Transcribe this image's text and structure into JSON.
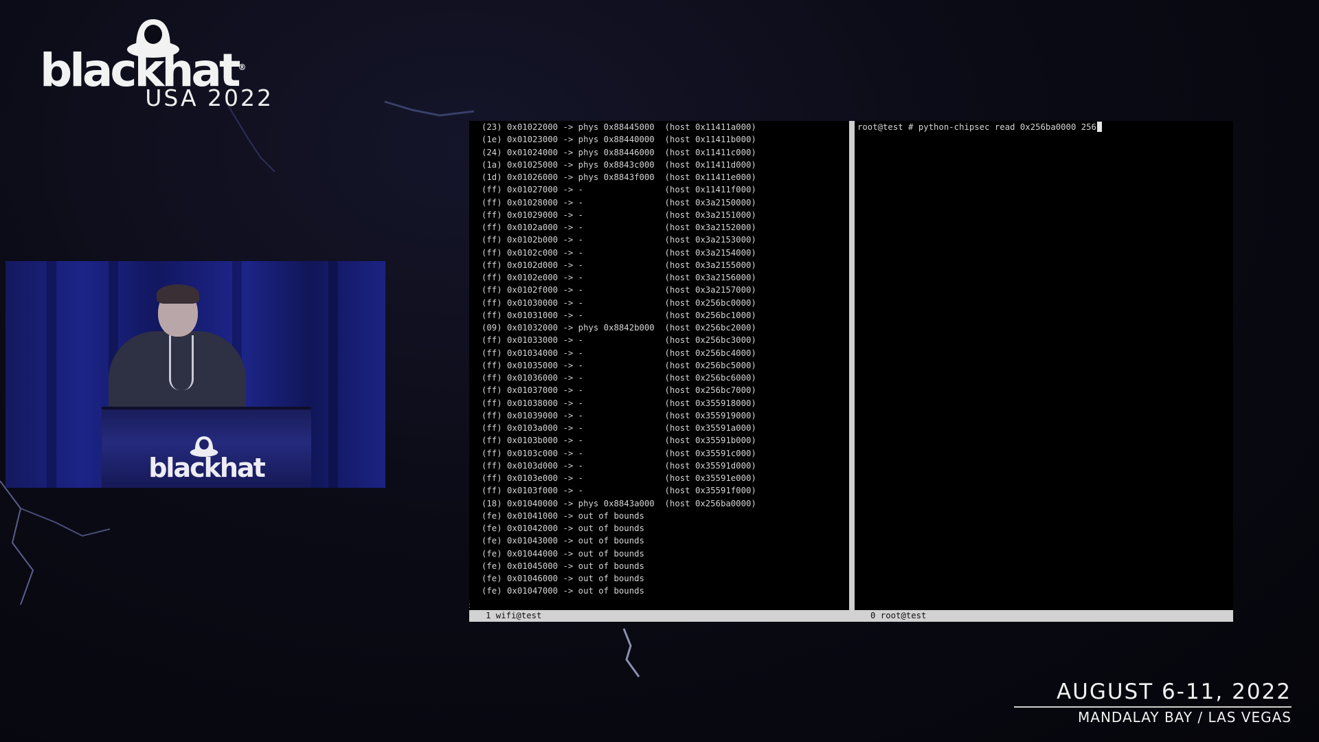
{
  "event": {
    "logo_word": "blackhat",
    "logo_registered": "®",
    "logo_sub": "USA 2022",
    "podium_word": "blackhat",
    "date": "AUGUST 6-11, 2022",
    "venue": "MANDALAY BAY / LAS VEGAS"
  },
  "terminal": {
    "left_pane_lines": [
      "(23) 0x01022000 -> phys 0x88445000  (host 0x11411a000)",
      "(1e) 0x01023000 -> phys 0x88440000  (host 0x11411b000)",
      "(24) 0x01024000 -> phys 0x88446000  (host 0x11411c000)",
      "(1a) 0x01025000 -> phys 0x8843c000  (host 0x11411d000)",
      "(1d) 0x01026000 -> phys 0x8843f000  (host 0x11411e000)",
      "(ff) 0x01027000 -> -                (host 0x11411f000)",
      "(ff) 0x01028000 -> -                (host 0x3a2150000)",
      "(ff) 0x01029000 -> -                (host 0x3a2151000)",
      "(ff) 0x0102a000 -> -                (host 0x3a2152000)",
      "(ff) 0x0102b000 -> -                (host 0x3a2153000)",
      "(ff) 0x0102c000 -> -                (host 0x3a2154000)",
      "(ff) 0x0102d000 -> -                (host 0x3a2155000)",
      "(ff) 0x0102e000 -> -                (host 0x3a2156000)",
      "(ff) 0x0102f000 -> -                (host 0x3a2157000)",
      "(ff) 0x01030000 -> -                (host 0x256bc0000)",
      "(ff) 0x01031000 -> -                (host 0x256bc1000)",
      "(09) 0x01032000 -> phys 0x8842b000  (host 0x256bc2000)",
      "(ff) 0x01033000 -> -                (host 0x256bc3000)",
      "(ff) 0x01034000 -> -                (host 0x256bc4000)",
      "(ff) 0x01035000 -> -                (host 0x256bc5000)",
      "(ff) 0x01036000 -> -                (host 0x256bc6000)",
      "(ff) 0x01037000 -> -                (host 0x256bc7000)",
      "(ff) 0x01038000 -> -                (host 0x355918000)",
      "(ff) 0x01039000 -> -                (host 0x355919000)",
      "(ff) 0x0103a000 -> -                (host 0x35591a000)",
      "(ff) 0x0103b000 -> -                (host 0x35591b000)",
      "(ff) 0x0103c000 -> -                (host 0x35591c000)",
      "(ff) 0x0103d000 -> -                (host 0x35591d000)",
      "(ff) 0x0103e000 -> -                (host 0x35591e000)",
      "(ff) 0x0103f000 -> -                (host 0x35591f000)",
      "(18) 0x01040000 -> phys 0x8843a000  (host 0x256ba0000)",
      "(fe) 0x01041000 -> out of bounds",
      "(fe) 0x01042000 -> out of bounds",
      "(fe) 0x01043000 -> out of bounds",
      "(fe) 0x01044000 -> out of bounds",
      "(fe) 0x01045000 -> out of bounds",
      "(fe) 0x01046000 -> out of bounds",
      "(fe) 0x01047000 -> out of bounds"
    ],
    "left_prompt": ":",
    "right_command": "root@test # python-chipsec read 0x256ba0000 256",
    "status_left": "1 wifi@test",
    "status_right": "0 root@test"
  },
  "colors": {
    "terminal_bg": "#000000",
    "terminal_fg": "#d4d4d4",
    "statusbar_bg": "#d2d2d2",
    "page_bg": "#0b0b16",
    "video_blue": "#1c2487"
  }
}
